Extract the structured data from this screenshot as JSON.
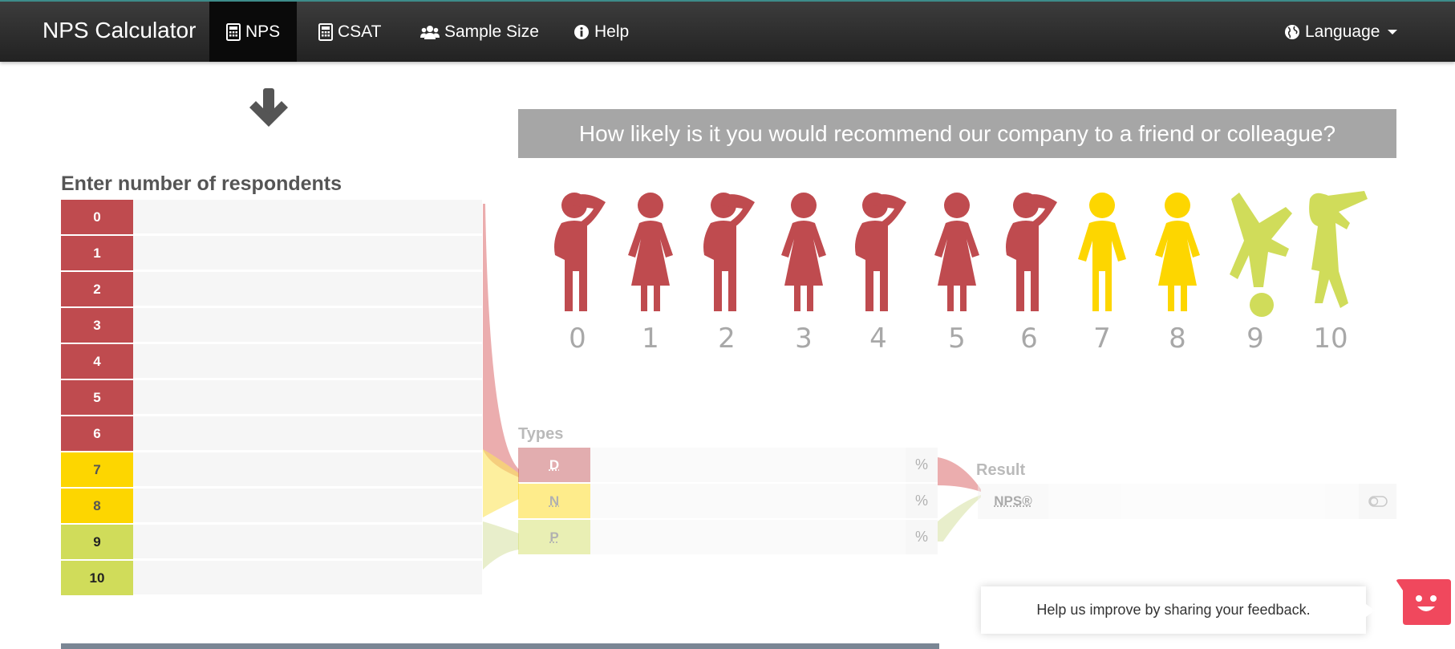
{
  "nav": {
    "brand": "NPS Calculator",
    "items": [
      {
        "label": "NPS",
        "icon": "calculator-icon",
        "active": true
      },
      {
        "label": "CSAT",
        "icon": "calculator-icon",
        "active": false
      },
      {
        "label": "Sample Size",
        "icon": "users-icon",
        "active": false
      },
      {
        "label": "Help",
        "icon": "info-circle-icon",
        "active": false
      }
    ],
    "language": {
      "label": "Language",
      "icon": "globe-icon"
    }
  },
  "left": {
    "title": "Enter number of respondents",
    "rows": [
      {
        "label": "0",
        "category": "detractor"
      },
      {
        "label": "1",
        "category": "detractor"
      },
      {
        "label": "2",
        "category": "detractor"
      },
      {
        "label": "3",
        "category": "detractor"
      },
      {
        "label": "4",
        "category": "detractor"
      },
      {
        "label": "5",
        "category": "detractor"
      },
      {
        "label": "6",
        "category": "detractor"
      },
      {
        "label": "7",
        "category": "passive"
      },
      {
        "label": "8",
        "category": "passive"
      },
      {
        "label": "9",
        "category": "promoter"
      },
      {
        "label": "10",
        "category": "promoter"
      }
    ]
  },
  "question": "How likely is it you would recommend our company to a friend or colleague?",
  "scale": [
    "0",
    "1",
    "2",
    "3",
    "4",
    "5",
    "6",
    "7",
    "8",
    "9",
    "10"
  ],
  "types": {
    "title": "Types",
    "rows": [
      {
        "label": "D",
        "unit": "%",
        "color": "#bf4b4f"
      },
      {
        "label": "N",
        "unit": "%",
        "color": "#fdd600"
      },
      {
        "label": "P",
        "unit": "%",
        "color": "#d0dc5a"
      }
    ]
  },
  "result": {
    "title": "Result",
    "label": "NPS®"
  },
  "feedback": {
    "text": "Help us improve by sharing your feedback."
  },
  "colors": {
    "detractor": "#bf4b4f",
    "passive": "#fdd600",
    "promoter": "#d0dc5a",
    "question_bg": "#a6a6a6"
  }
}
